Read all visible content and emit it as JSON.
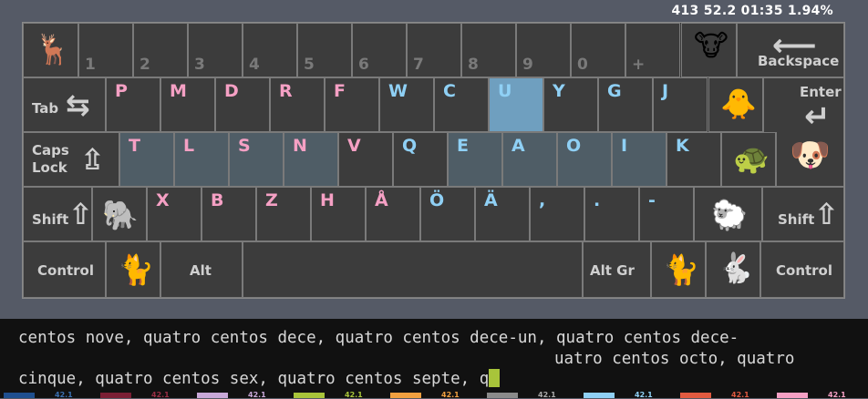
{
  "stats": "413 52.2 01:35 1.94%",
  "row1": {
    "digits": [
      "1",
      "2",
      "3",
      "4",
      "5",
      "6",
      "7",
      "8",
      "9",
      "0",
      "+"
    ],
    "left_emoji": "🦌",
    "right_emoji": "🐮",
    "backspace_label": "Backspace",
    "backspace_icon": "⟵"
  },
  "row2": {
    "tab_label": "Tab",
    "tab_icon": "⇆",
    "letters": [
      "P",
      "M",
      "D",
      "R",
      "F",
      "W",
      "C",
      "U",
      "Y",
      "G",
      "J"
    ],
    "colors": [
      "pink",
      "pink",
      "pink",
      "pink",
      "pink",
      "blue",
      "blue",
      "blue",
      "blue",
      "blue",
      "blue"
    ],
    "highlight_index": 7,
    "emoji": "🐥",
    "enter_label": "Enter",
    "enter_icon": "↵"
  },
  "row3": {
    "caps_label_1": "Caps",
    "caps_label_2": "Lock",
    "caps_icon": "⇫",
    "letters": [
      "T",
      "L",
      "S",
      "N",
      "V",
      "Q",
      "E",
      "A",
      "O",
      "I",
      "K"
    ],
    "colors": [
      "pink",
      "pink",
      "pink",
      "pink",
      "pink",
      "blue",
      "blue",
      "blue",
      "blue",
      "blue",
      "blue"
    ],
    "emoji_turtle": "🐢",
    "emoji_dog": "🐶"
  },
  "row4": {
    "shift_label": "Shift",
    "shift_icon": "⇧",
    "emoji_left": "🐘",
    "letters": [
      "X",
      "B",
      "Z",
      "H",
      "Å",
      "Ö",
      "Ä",
      ",",
      ".",
      "-"
    ],
    "colors": [
      "pink",
      "pink",
      "pink",
      "pink",
      "pink",
      "blue",
      "blue",
      "blue",
      "blue",
      "blue"
    ],
    "emoji_right": "🐑",
    "shift_right_label": "Shift",
    "shift_right_icon": "⇧"
  },
  "row5": {
    "control_left": "Control",
    "emoji_left": "🐈",
    "alt": "Alt",
    "altgr": "Alt Gr",
    "emoji_mid": "🐈",
    "emoji_right": "🐇",
    "control_right": "Control"
  },
  "terminal": {
    "line1": "centos nove, quatro centos dece, quatro centos dece-un, quatro centos dece-",
    "line2": "uatro centos octo, quatro",
    "line3": "cinque, quatro centos sex, quatro centos septe, q"
  },
  "swatches": [
    {
      "color": "#1f4f8f",
      "label": "42.1",
      "label_color": "#3a6fb0"
    },
    {
      "color": "#7a1e34",
      "label": "42.1",
      "label_color": "#9a2e44"
    },
    {
      "color": "#c8a8d8",
      "label": "42.1",
      "label_color": "#c8a8d8"
    },
    {
      "color": "#a8c43a",
      "label": "42.1",
      "label_color": "#a8c43a"
    },
    {
      "color": "#f0a040",
      "label": "42.1",
      "label_color": "#f0a040"
    },
    {
      "color": "#8a8a8a",
      "label": "42.1",
      "label_color": "#aaaaaa"
    },
    {
      "color": "#8fd0f5",
      "label": "42.1",
      "label_color": "#8fd0f5"
    },
    {
      "color": "#e05a40",
      "label": "42.1",
      "label_color": "#e05a40"
    },
    {
      "color": "#f5a0c4",
      "label": "42.1",
      "label_color": "#f5a0c4"
    }
  ]
}
